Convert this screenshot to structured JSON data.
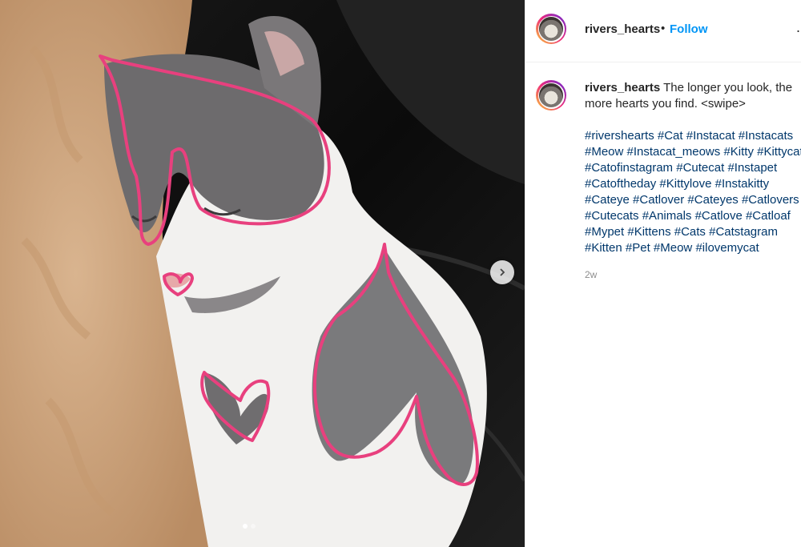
{
  "post": {
    "image_alt": "Gray and white cat sleeping with pink hearts drawn on its fur",
    "carousel": {
      "total_slides": 2,
      "active_slide": 1
    },
    "accent_color": "#e8407e"
  },
  "header": {
    "username": "rivers_hearts",
    "separator": "•",
    "follow_label": "Follow",
    "more_icon": "more-horizontal-icon",
    "more_label": "..."
  },
  "caption": {
    "username": "rivers_hearts",
    "text": "The longer you look, the more hearts you find. <swipe>",
    "hashtags": [
      "#rivershearts",
      "#Cat",
      "#Instacat",
      "#Instacats",
      "#Meow",
      "#Instacat_meows",
      "#Kitty",
      "#Kittycat",
      "#Catofinstagram",
      "#Cutecat",
      "#Instapet",
      "#Catoftheday",
      "#Kittylove",
      "#Instakitty",
      "#Cateye",
      "#Catlover",
      "#Cateyes",
      "#Catlovers",
      "#Cutecats",
      "#Animals",
      "#Catlove",
      "#Catloaf",
      "#Mypet",
      "#Kittens",
      "#Cats",
      "#Catstagram",
      "#Kitten",
      "#Pet",
      "#Meow",
      "#ilovemycat"
    ],
    "timestamp": "2w"
  },
  "colors": {
    "link": "#0095f6",
    "hashtag": "#00376b",
    "text": "#262626",
    "muted": "#8e8e8e"
  }
}
